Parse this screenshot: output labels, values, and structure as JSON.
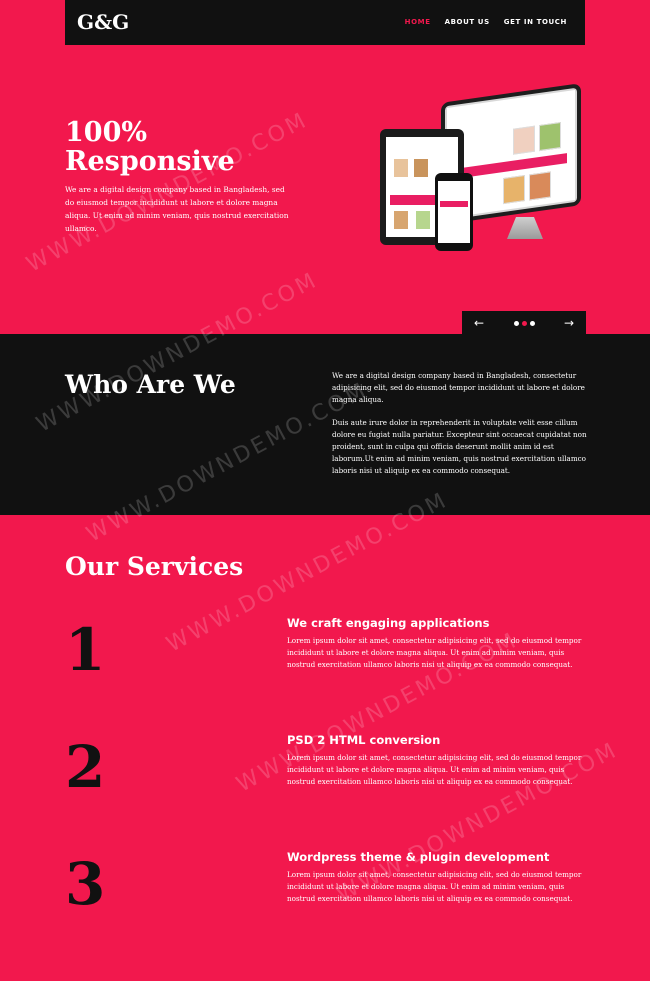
{
  "brand": {
    "logo": "G&G"
  },
  "nav": {
    "items": [
      {
        "label": "HOME",
        "active": true
      },
      {
        "label": "ABOUT US",
        "active": false
      },
      {
        "label": "GET IN TOUCH",
        "active": false
      }
    ]
  },
  "hero": {
    "title": "100% Responsive",
    "text": "We are a digital design company based in Bangladesh, sed do eiusmod tempor incididunt ut labore et dolore magna aliqua. Ut enim ad minim veniam, quis nostrud exercitation ullamco."
  },
  "slider": {
    "prev_icon": "←",
    "next_icon": "→",
    "dot_count": 3,
    "active_dot": 1
  },
  "about": {
    "title": "Who Are We",
    "paragraph1": "We are a digital design company based in Bangladesh, consectetur adipisicing elit, sed do eiusmod tempor incididunt ut labore et dolore magna aliqua.",
    "paragraph2": "Duis aute irure dolor in reprehenderit in voluptate velit esse cillum dolore eu fugiat nulla pariatur. Excepteur sint occaecat cupidatat non proident, sunt in culpa qui officia deserunt mollit anim id est laborum.Ut enim ad minim veniam, quis nostrud exercitation ullamco laboris nisi ut aliquip ex ea commodo consequat."
  },
  "services": {
    "title": "Our Services",
    "items": [
      {
        "number": "1",
        "title": "We craft engaging applications",
        "text": "Lorem ipsum dolor sit amet, consectetur adipisicing elit, sed do eiusmod tempor incididunt ut labore et dolore magna aliqua. Ut enim ad minim veniam, quis nostrud exercitation ullamco laboris nisi ut aliquip ex ea commodo consequat."
      },
      {
        "number": "2",
        "title": "PSD 2 HTML conversion",
        "text": "Lorem ipsum dolor sit amet, consectetur adipisicing elit, sed do eiusmod tempor incididunt ut labore et dolore magna aliqua. Ut enim ad minim veniam, quis nostrud exercitation ullamco laboris nisi ut aliquip ex ea commodo consequat."
      },
      {
        "number": "3",
        "title": "Wordpress theme & plugin development",
        "text": "Lorem ipsum dolor sit amet, consectetur adipisicing elit, sed do eiusmod tempor incididunt ut labore et dolore magna aliqua. Ut enim ad minim veniam, quis nostrud exercitation ullamco laboris nisi ut aliquip ex ea commodo consequat."
      }
    ]
  },
  "watermark": "WWW.DOWNDEMO.COM",
  "colors": {
    "accent": "#f2184d",
    "dark": "#111111",
    "text": "#ffffff"
  }
}
